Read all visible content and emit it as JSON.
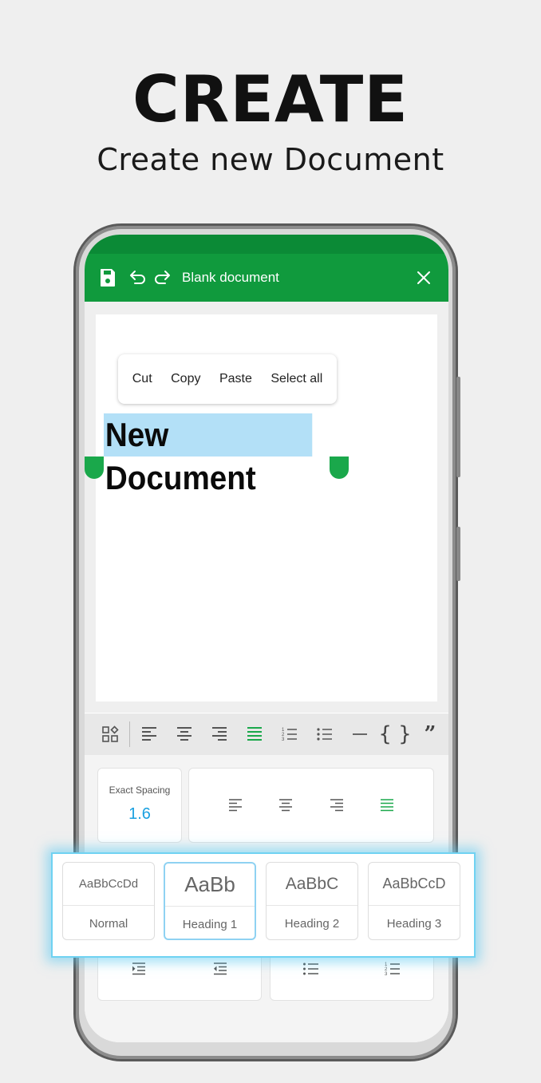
{
  "promo": {
    "title": "CREATE",
    "subtitle": "Create new Document"
  },
  "app_bar": {
    "title": "Blank document"
  },
  "context_menu": {
    "items": [
      "Cut",
      "Copy",
      "Paste",
      "Select all"
    ]
  },
  "document": {
    "selected_text": "New Document"
  },
  "toolbar": {
    "icons": [
      "widgets-icon",
      "align-left-icon",
      "align-center-icon",
      "align-right-icon",
      "align-justify-icon",
      "numbered-list-icon",
      "bullet-list-icon",
      "horizontal-rule-icon",
      "code-block-icon",
      "quote-icon"
    ],
    "active": "align-justify-icon"
  },
  "spacing": {
    "label": "Exact Spacing",
    "value": "1.6"
  },
  "styles": [
    {
      "sample": "AaBbCcDd",
      "name": "Normal"
    },
    {
      "sample": "AaBb",
      "name": "Heading 1"
    },
    {
      "sample": "AaBbC",
      "name": "Heading 2"
    },
    {
      "sample": "AaBbCcD",
      "name": "Heading 3"
    }
  ],
  "colors": {
    "accent_green": "#109a3d",
    "selection": "#b3e0f7",
    "spacing_value": "#1aa0e0"
  }
}
